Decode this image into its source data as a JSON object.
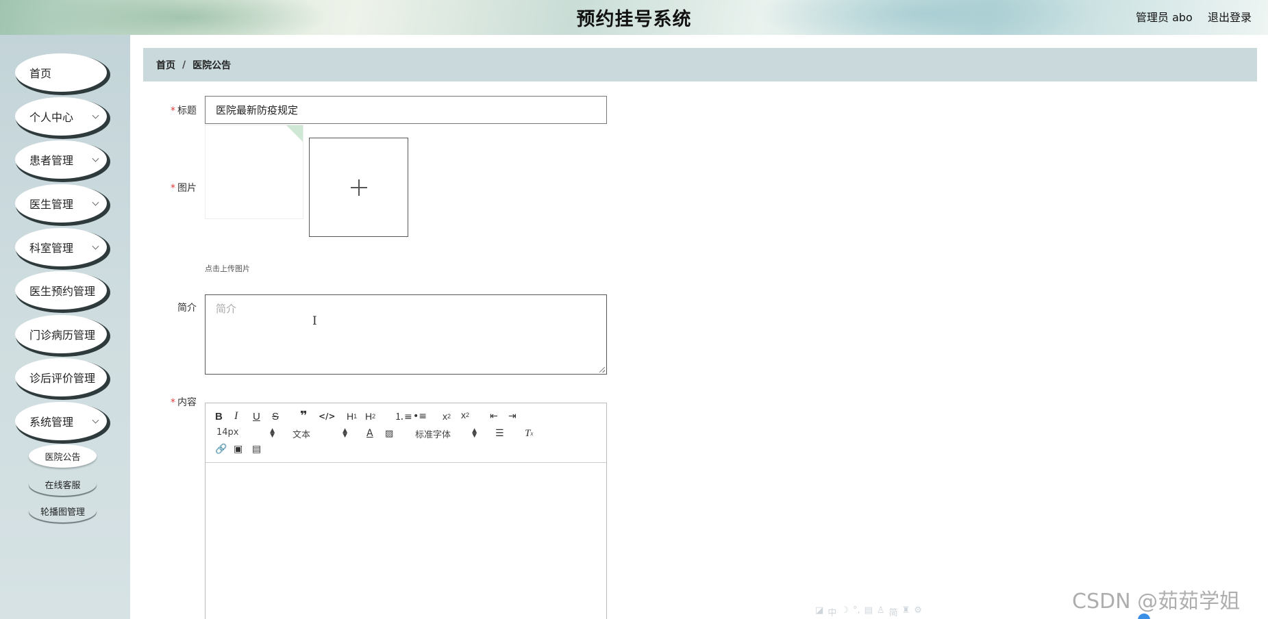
{
  "header": {
    "title": "预约挂号系统",
    "user": "管理员 abo",
    "logout": "退出登录"
  },
  "sidebar": {
    "items": [
      {
        "label": "首页",
        "has_arrow": false
      },
      {
        "label": "个人中心",
        "has_arrow": true
      },
      {
        "label": "患者管理",
        "has_arrow": true
      },
      {
        "label": "医生管理",
        "has_arrow": true
      },
      {
        "label": "科室管理",
        "has_arrow": true
      },
      {
        "label": "医生预约管理",
        "has_arrow": false
      },
      {
        "label": "门诊病历管理",
        "has_arrow": false
      },
      {
        "label": "诊后评价管理",
        "has_arrow": false
      },
      {
        "label": "系统管理",
        "has_arrow": true
      }
    ],
    "sub_items": [
      {
        "label": "医院公告",
        "active": true
      },
      {
        "label": "在线客服",
        "active": false
      },
      {
        "label": "轮播图管理",
        "active": false
      }
    ]
  },
  "breadcrumb": {
    "home": "首页",
    "separator": "/",
    "current": "医院公告"
  },
  "form": {
    "title_label": "标题",
    "title_value": "医院最新防疫规定",
    "image_label": "图片",
    "upload_tip": "点击上传图片",
    "intro_label": "简介",
    "intro_placeholder": "简介",
    "content_label": "内容",
    "required_mark": "*"
  },
  "editor": {
    "font_size": "14px",
    "paragraph": "文本",
    "font_family": "标准字体"
  },
  "watermark": "CSDN @茹茹学姐",
  "ime_bar": [
    "中",
    "简"
  ]
}
